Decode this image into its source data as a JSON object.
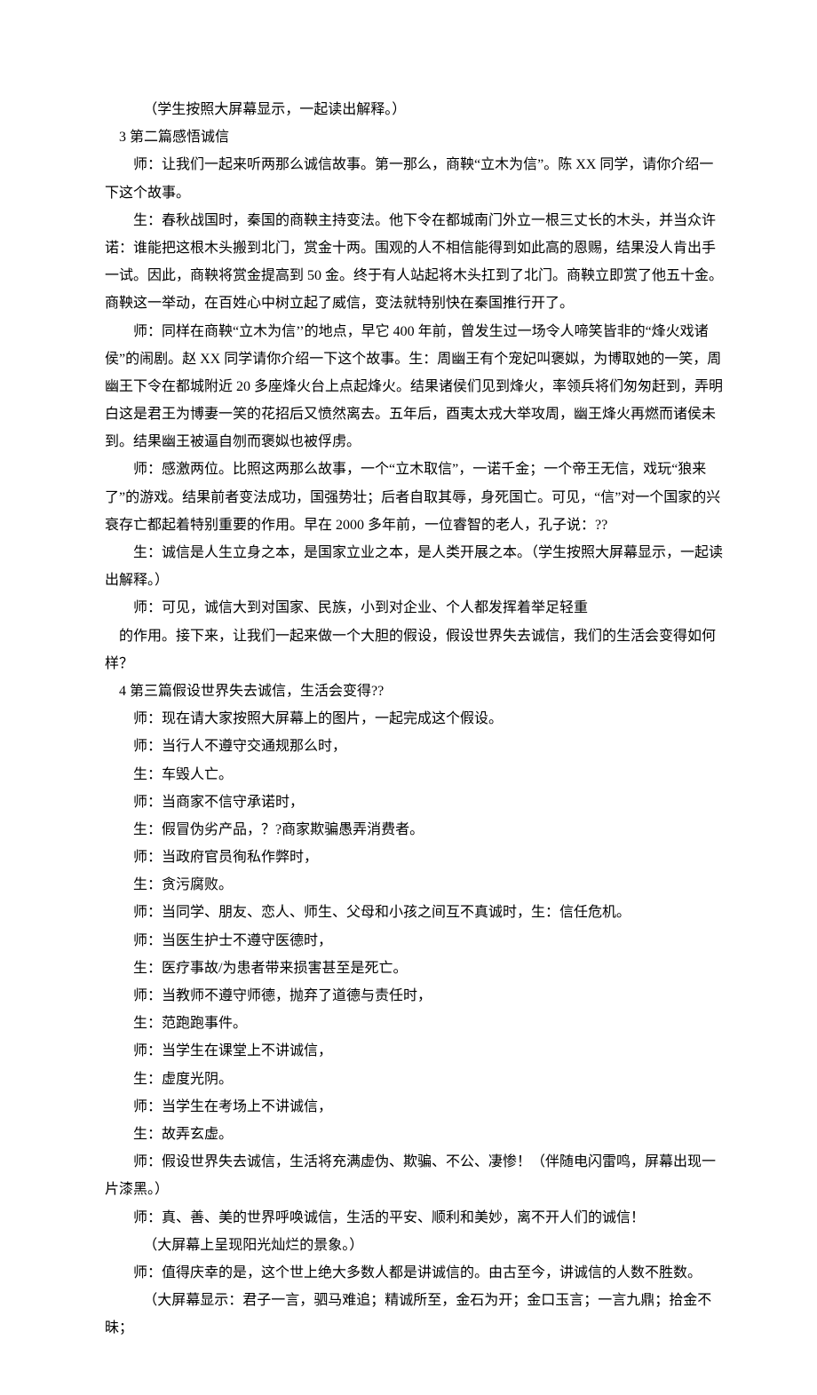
{
  "lines": [
    {
      "cls": "para indent-3",
      "text": "（学生按照大屏幕显示，一起读出解释。）"
    },
    {
      "cls": "para indent-1",
      "text": "3 第二篇感悟诚信"
    },
    {
      "cls": "para",
      "text": "师：让我们一起来听两那么诚信故事。第一那么，商鞅“立木为信”。陈 XX 同学，请你介绍一下这个故事。"
    },
    {
      "cls": "para",
      "text": "生：春秋战国时，秦国的商鞅主持变法。他下令在都城南门外立一根三丈长的木头，并当众许诺：谁能把这根木头搬到北门，赏金十两。围观的人不相信能得到如此高的恩赐，结果没人肯出手一试。因此，商鞅将赏金提高到 50 金。终于有人站起将木头扛到了北门。商鞅立即赏了他五十金。商鞅这一举动，在百姓心中树立起了威信，变法就特别快在秦国推行开了。"
    },
    {
      "cls": "para",
      "text": "师：同样在商鞅“立木为信’’的地点，早它 400 年前，曾发生过一场令人啼笑皆非的“烽火戏诸侯”的闹剧。赵 XX 同学请你介绍一下这个故事。生：周幽王有个宠妃叫褒姒，为博取她的一笑，周幽王下令在都城附近 20 多座烽火台上点起烽火。结果诸侯们见到烽火，率领兵将们匆匆赶到，弄明白这是君王为博妻一笑的花招后又愤然离去。五年后，酉夷太戎大举攻周，幽王烽火再燃而诸侯未到。结果幽王被逼自刎而褒姒也被俘虏。"
    },
    {
      "cls": "para",
      "text": "师：感激两位。比照这两那么故事，一个“立木取信”，一诺千金；一个帝王无信，戏玩“狼来了”的游戏。结果前者变法成功，国强势壮；后者自取其辱，身死国亡。可见，“信”对一个国家的兴衰存亡都起着特别重要的作用。早在 2000 多年前，一位睿智的老人，孔子说：??"
    },
    {
      "cls": "para",
      "text": "生：诚信是人生立身之本，是国家立业之本，是人类开展之本。（学生按照大屏幕显示，一起读出解释。）"
    },
    {
      "cls": "para",
      "text": "师：可见，诚信大到对国家、民族，小到对企业、个人都发挥着举足轻重"
    },
    {
      "cls": "para indent-1",
      "text": "的作用。接下来，让我们一起来做一个大胆的假设，假设世界失去诚信，我们的生活会变得如何样？"
    },
    {
      "cls": "para indent-1",
      "text": "4 第三篇假设世界失去诚信，生活会变得??"
    },
    {
      "cls": "para",
      "text": "师：现在请大家按照大屏幕上的图片，一起完成这个假设。"
    },
    {
      "cls": "para",
      "text": "师：当行人不遵守交通规那么时，"
    },
    {
      "cls": "para",
      "text": "生：车毁人亡。"
    },
    {
      "cls": "para",
      "text": "师：当商家不信守承诺时，"
    },
    {
      "cls": "para",
      "text": "生：假冒伪劣产品，？?商家欺骗愚弄消费者。"
    },
    {
      "cls": "para",
      "text": "师：当政府官员徇私作弊时，"
    },
    {
      "cls": "para",
      "text": "生：贪污腐败。"
    },
    {
      "cls": "para",
      "text": "师：当同学、朋友、恋人、师生、父母和小孩之间互不真诚时，生：信任危机。"
    },
    {
      "cls": "para",
      "text": "师：当医生护士不遵守医德时，"
    },
    {
      "cls": "para",
      "text": "生：医疗事故/为患者带来损害甚至是死亡。"
    },
    {
      "cls": "para",
      "text": "师：当教师不遵守师德，抛弃了道德与责任时，"
    },
    {
      "cls": "para",
      "text": "生：范跑跑事件。"
    },
    {
      "cls": "para",
      "text": "师：当学生在课堂上不讲诚信，"
    },
    {
      "cls": "para",
      "text": "生：虚度光阴。"
    },
    {
      "cls": "para",
      "text": "师：当学生在考场上不讲诚信，"
    },
    {
      "cls": "para",
      "text": "生：故弄玄虚。"
    },
    {
      "cls": "para",
      "text": "师：假设世界失去诚信，生活将充满虚伪、欺骗、不公、凄惨！（伴随电闪雷鸣，屏幕出现一片漆黑。）"
    },
    {
      "cls": "para",
      "text": "师：真、善、美的世界呼唤诚信，生活的平安、顺利和美妙，离不开人们的诚信！"
    },
    {
      "cls": "para indent-3",
      "text": "（大屏幕上呈现阳光灿烂的景象。）"
    },
    {
      "cls": "para",
      "text": "师：值得庆幸的是，这个世上绝大多数人都是讲诚信的。由古至今，讲诚信的人数不胜数。"
    },
    {
      "cls": "para indent-3",
      "text": "（大屏幕显示：君子一言，驷马难追；精诚所至，金石为开；金口玉言；一言九鼎；拾金不昧；"
    }
  ]
}
